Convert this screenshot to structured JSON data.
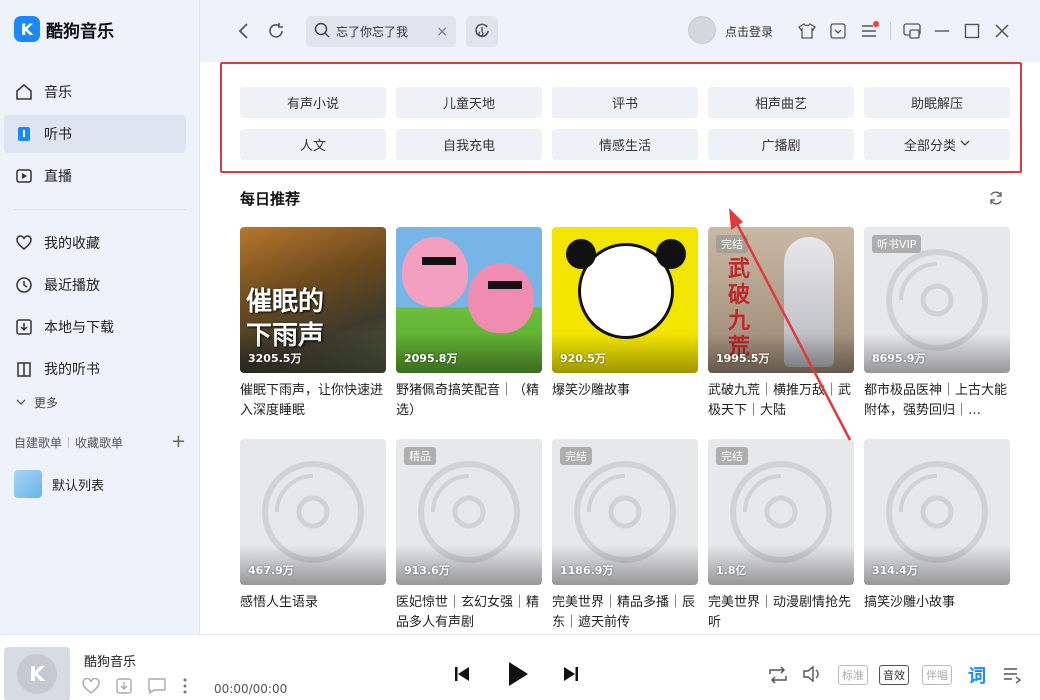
{
  "app": {
    "name": "酷狗音乐",
    "logo_letter": "K"
  },
  "sidebar": {
    "items": [
      {
        "label": "音乐",
        "icon": "home-icon"
      },
      {
        "label": "听书",
        "icon": "audiobook-icon",
        "active": true
      },
      {
        "label": "直播",
        "icon": "live-icon"
      },
      {
        "label": "我的收藏",
        "icon": "heart-icon"
      },
      {
        "label": "最近播放",
        "icon": "clock-icon"
      },
      {
        "label": "本地与下载",
        "icon": "download-icon"
      },
      {
        "label": "我的听书",
        "icon": "book-icon"
      }
    ],
    "more_label": "更多",
    "playlist_tab_own": "自建歌单",
    "playlist_tab_fav": "收藏歌单",
    "default_list": "默认列表"
  },
  "topbar": {
    "search_value": "忘了你忘了我",
    "login_label": "点击登录"
  },
  "categories": {
    "row1": [
      "有声小说",
      "儿童天地",
      "评书",
      "相声曲艺",
      "助眠解压"
    ],
    "row2": [
      "人文",
      "自我充电",
      "情感生活",
      "广播剧",
      "全部分类"
    ]
  },
  "section": {
    "title": "每日推荐"
  },
  "cards": [
    {
      "count": "3205.5万",
      "title": "催眠下雨声，让你快速进入深度睡眠",
      "cover_text": "催眠的\n下雨声"
    },
    {
      "count": "2095.8万",
      "title": "野猪佩奇搞笑配音｜（精选）"
    },
    {
      "count": "920.5万",
      "title": "爆笑沙雕故事"
    },
    {
      "count": "1995.5万",
      "title": "武破九荒｜横推万敌｜武极天下｜大陆",
      "tag": "完结",
      "cover_text": "武破九荒"
    },
    {
      "count": "8695.9万",
      "title": "都市极品医神｜上古大能附体，强势回归｜…",
      "tag": "听书VIP"
    },
    {
      "count": "467.9万",
      "title": "感悟人生语录"
    },
    {
      "count": "913.6万",
      "title": "医妃惊世｜玄幻女强｜精品多人有声剧",
      "tag": "精品"
    },
    {
      "count": "1186.9万",
      "title": "完美世界｜精品多播｜辰东｜遮天前传",
      "tag": "完结"
    },
    {
      "count": "1.8亿",
      "title": "完美世界｜动漫剧情抢先听",
      "tag": "完结"
    },
    {
      "count": "314.4万",
      "title": "搞笑沙雕小故事"
    }
  ],
  "player": {
    "title": "酷狗音乐",
    "time": "00:00/00:00",
    "quality_standard": "标准",
    "quality_sound": "音效",
    "quality_accompany": "伴唱",
    "lyric_label": "词"
  },
  "colors": {
    "accent": "#1a88ff",
    "highlight_box": "#e23a3a",
    "sidebar_bg": "#eef2fa"
  }
}
